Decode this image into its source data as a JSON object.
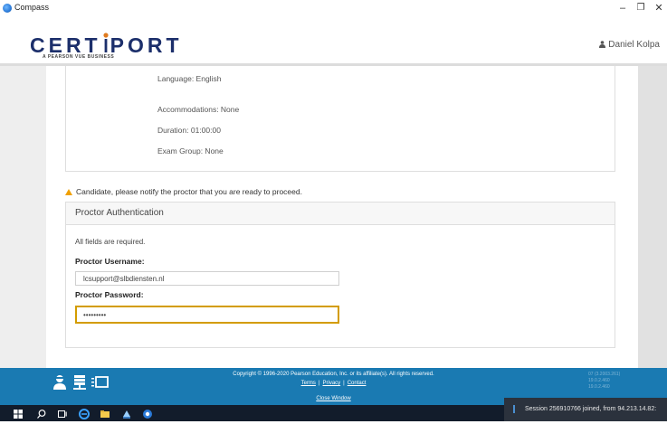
{
  "window": {
    "title": "Compass"
  },
  "header": {
    "logo_text_left": "CERT",
    "logo_text_right": "PORT",
    "tagline": "A PEARSON VUE BUSINESS",
    "user_name": "Daniel Kolpa"
  },
  "exam_info": {
    "language": "Language: English",
    "accommodations": "Accommodations: None",
    "duration": "Duration: 01:00:00",
    "exam_group": "Exam Group: None"
  },
  "notice": "Candidate, please notify the proctor that you are ready to proceed.",
  "auth": {
    "title": "Proctor Authentication",
    "required_note": "All fields are required.",
    "username_label": "Proctor Username:",
    "username_value": "lcsupport@slbdiensten.nl",
    "password_label": "Proctor Password:",
    "password_value": "•••••••••"
  },
  "footer": {
    "copyright": "Copyright © 1996-2020 Pearson Education, Inc. or its affiliate(s). All rights reserved.",
    "terms": "Terms",
    "privacy": "Privacy",
    "contact": "Contact",
    "close_window": "Close Window",
    "version_1": "07 (3.2003.261)",
    "version_2": "19.0.2.460",
    "version_3": "19.0.2.460"
  },
  "taskbar": {
    "session_text": "Session 256910766 joined, from 94.213.14.82:"
  },
  "colors": {
    "footer_blue": "#1a7ab2",
    "logo_navy": "#1c2f6b",
    "focus_gold": "#d39c00",
    "warning": "#f0a000"
  }
}
